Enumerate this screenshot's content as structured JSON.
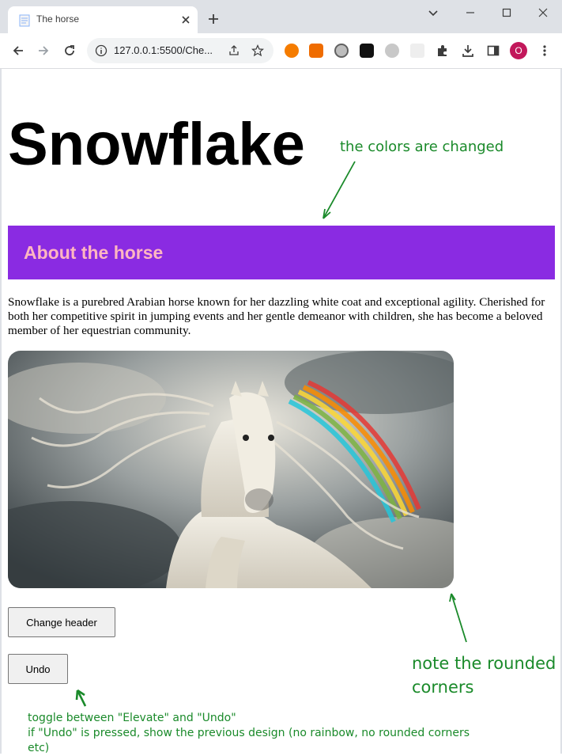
{
  "browser": {
    "tab_title": "The horse",
    "url": "127.0.0.1:5500/Che...",
    "profile_initial": "O"
  },
  "page": {
    "title": "Snowflake",
    "section_heading": "About the horse",
    "description": "Snowflake is a purebred Arabian horse known for her dazzling white coat and exceptional agility. Cherished for both her competitive spirit in jumping events and her gentle demeanor with children, she has become a beloved member of her equestrian community.",
    "buttons": {
      "change_header": "Change header",
      "undo": "Undo"
    },
    "colors": {
      "header_bg": "#8a2be2",
      "header_text": "#ffb6c1"
    }
  },
  "annotations": {
    "colors_changed": "the colors are changed",
    "rounded_corners_line1": "note the rounded",
    "rounded_corners_line2": "corners",
    "toggle_line1": "toggle between \"Elevate\" and \"Undo\"",
    "toggle_line2": "if \"Undo\" is pressed, show the previous design (no rainbow, no rounded corners etc)"
  }
}
